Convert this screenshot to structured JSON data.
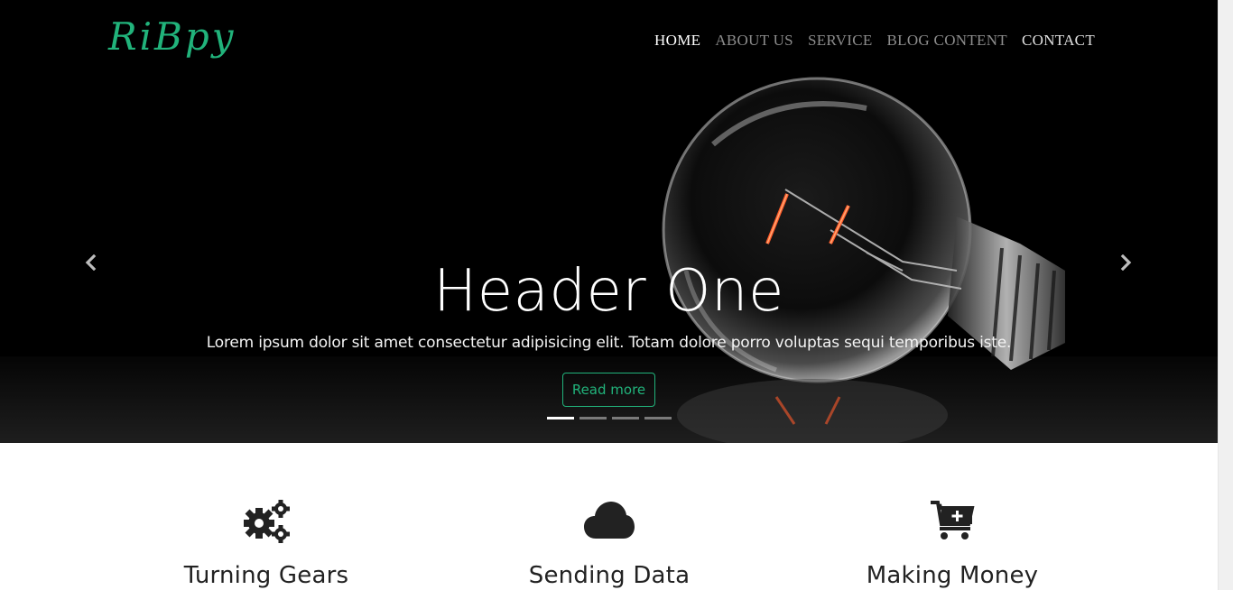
{
  "brand": {
    "logo_text": "RiBpy",
    "accent_color": "#21b37b"
  },
  "nav": {
    "items": [
      {
        "label": "HOME",
        "active": true
      },
      {
        "label": "ABOUT US",
        "active": false
      },
      {
        "label": "SERVICE",
        "active": false
      },
      {
        "label": "BLOG CONTENT",
        "active": false
      },
      {
        "label": "CONTACT",
        "active": false
      }
    ]
  },
  "carousel": {
    "title": "Header One",
    "text": "Lorem ipsum dolor sit amet consectetur adipisicing elit. Totam dolore porro voluptas sequi temporibus iste.",
    "button_label": "Read more",
    "prev_icon": "chevron-left-icon",
    "next_icon": "chevron-right-icon",
    "slide_count": 4,
    "active_slide": 1
  },
  "features": [
    {
      "icon": "gears-icon",
      "title": "Turning Gears"
    },
    {
      "icon": "cloud-icon",
      "title": "Sending Data"
    },
    {
      "icon": "cart-plus-icon",
      "title": "Making Money"
    }
  ]
}
